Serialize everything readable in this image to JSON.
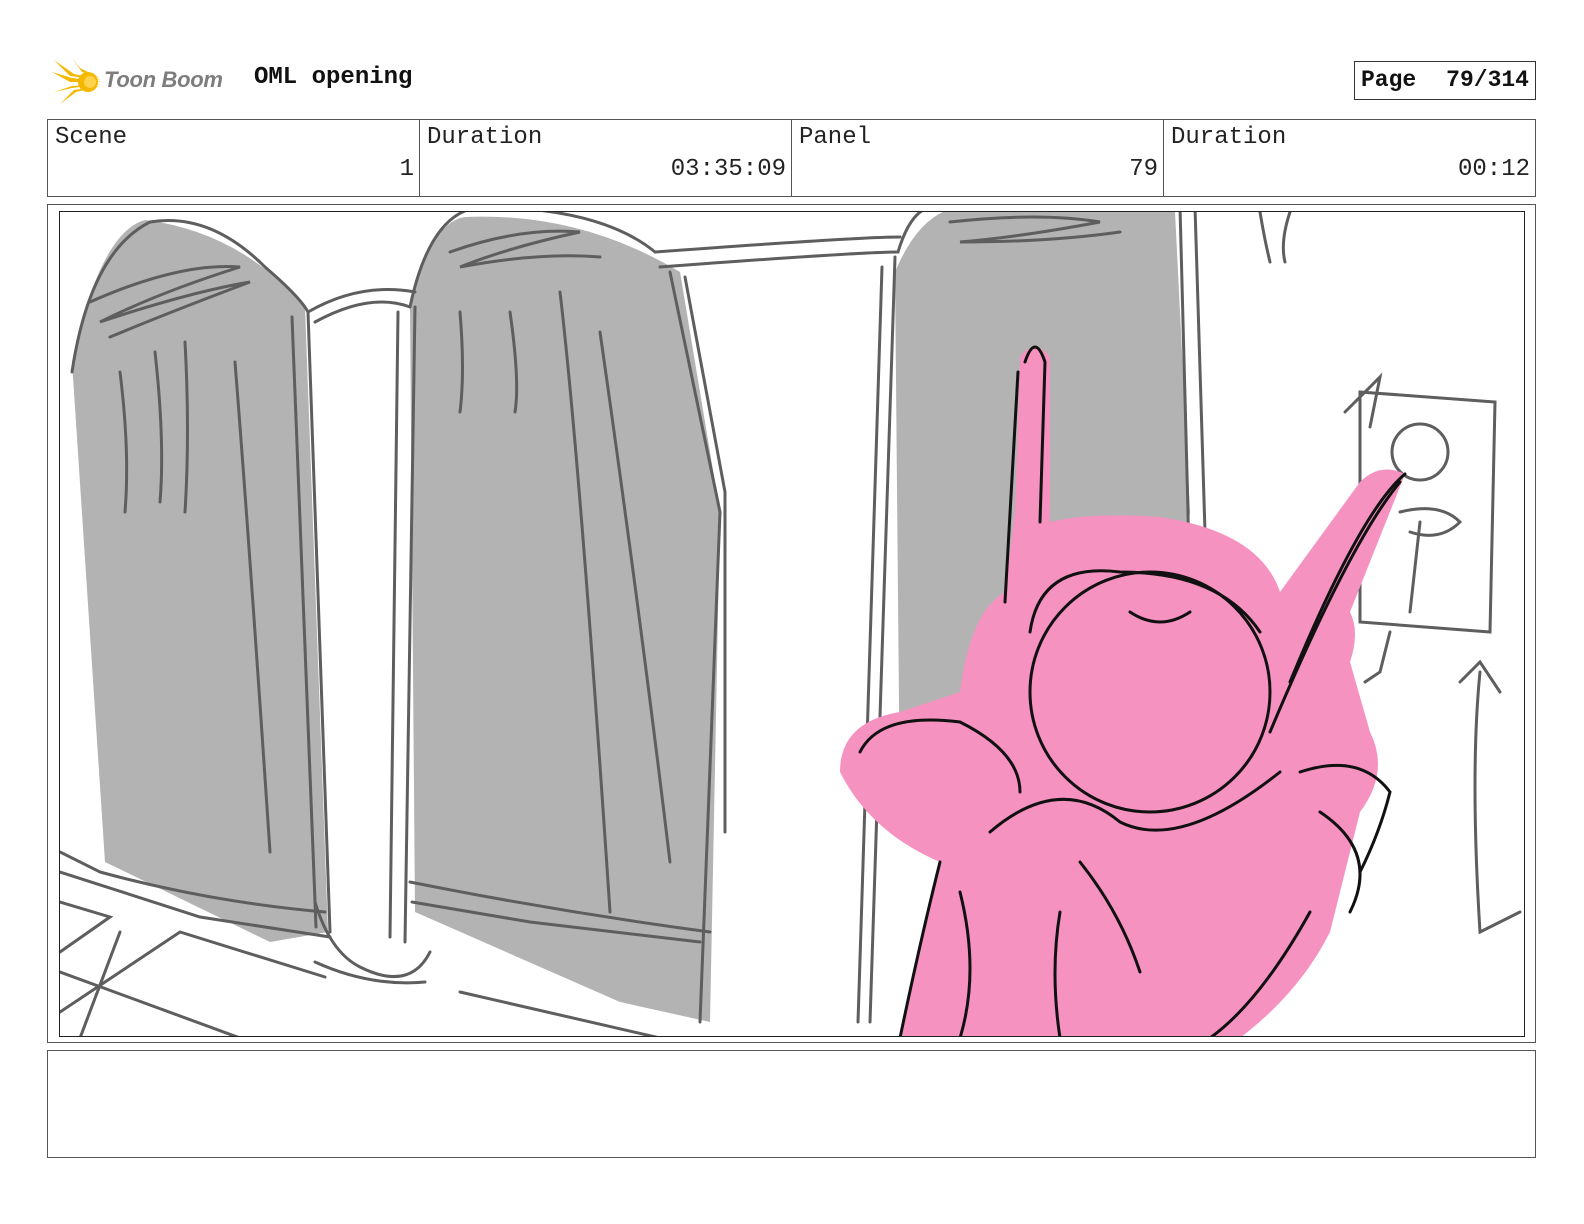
{
  "header": {
    "logo_text": "Toon Boom",
    "project_title": "OML opening",
    "page_label": "Page",
    "page_value": "79/314"
  },
  "info": {
    "scene_label": "Scene",
    "scene_value": "1",
    "scene_duration_label": "Duration",
    "scene_duration_value": "03:35:09",
    "panel_label": "Panel",
    "panel_value": "79",
    "panel_duration_label": "Duration",
    "panel_duration_value": "00:12"
  },
  "panel": {
    "description": "",
    "colors": {
      "wall_shade": "#b3b3b3",
      "line": "#5e5e5e",
      "character_fill": "#f592c0",
      "character_line": "#111111"
    }
  },
  "notes": {
    "text": ""
  },
  "colors": {
    "logo_star": "#f5b800",
    "border": "#555555"
  }
}
